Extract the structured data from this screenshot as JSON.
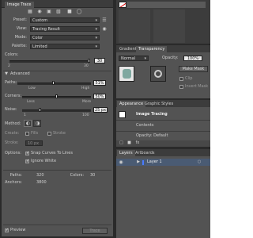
{
  "image_trace": {
    "title": "Image Trace",
    "preset": {
      "label": "Preset:",
      "value": "Custom"
    },
    "view": {
      "label": "View:",
      "value": "Tracing Result"
    },
    "mode": {
      "label": "Mode:",
      "value": "Color"
    },
    "palette": {
      "label": "Palette:",
      "value": "Limited"
    },
    "colors": {
      "label": "Colors:",
      "value": "30",
      "min": "2",
      "max": "30",
      "fraction": 1.0
    },
    "advanced_label": "Advanced",
    "paths": {
      "label": "Paths:",
      "value": "51%",
      "low": "Low",
      "high": "High",
      "fraction": 0.51
    },
    "corners": {
      "label": "Corners:",
      "value": "50%",
      "low": "Less",
      "high": "More",
      "fraction": 0.5
    },
    "noise": {
      "label": "Noise:",
      "value": "25 px",
      "min": "1",
      "max": "100",
      "fraction": 0.25
    },
    "method": {
      "label": "Method:"
    },
    "create": {
      "label": "Create:",
      "fills": "Fills",
      "strokes": "Stroke"
    },
    "stroke": {
      "label": "Stroke:",
      "value": "10 px"
    },
    "options": {
      "label": "Options:",
      "snap": "Snap Curves To Lines",
      "ignore_white": "Ignore White"
    },
    "stats": {
      "paths_label": "Paths:",
      "paths_value": "320",
      "colors_label": "Colors:",
      "colors_value": "30",
      "anchors_label": "Anchors:",
      "anchors_value": "3800"
    },
    "preview_label": "Preview",
    "trace_button": "Trace"
  },
  "transparency": {
    "tabs": [
      "Gradient",
      "Transparency"
    ],
    "blend": "Normal",
    "opacity_label": "Opacity:",
    "opacity_value": "100%",
    "make_mask": "Make Mask",
    "clip": "Clip",
    "invert_mask": "Invert Mask"
  },
  "appearance": {
    "tabs": [
      "Appearance",
      "Graphic Styles"
    ],
    "object": "Image Tracing",
    "contents": "Contents",
    "opacity_row": "Opacity: Default"
  },
  "layers": {
    "tabs": [
      "Layers",
      "Artboards"
    ],
    "layer_name": "Layer 1"
  }
}
